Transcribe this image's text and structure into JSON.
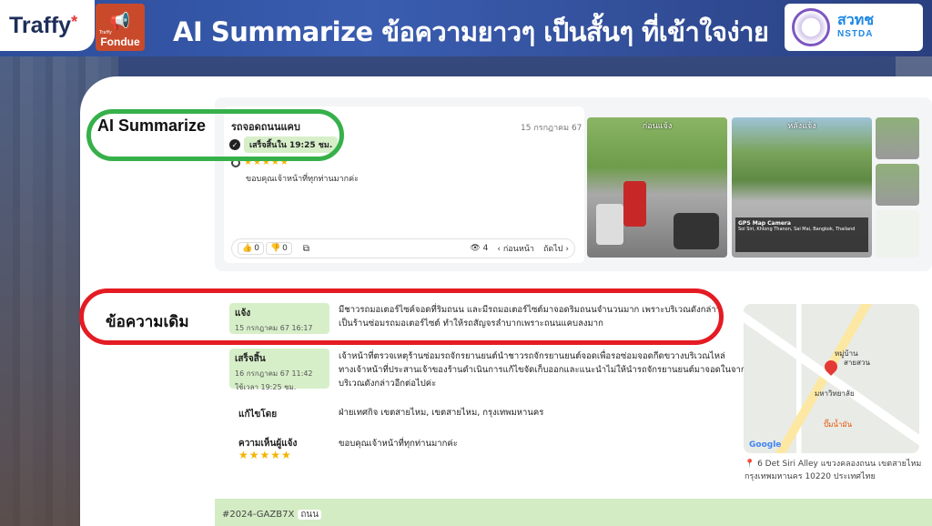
{
  "header": {
    "logo_traffy": "Traffy",
    "logo_traffy_star": "*",
    "logo_fondue_small": "Traffy",
    "logo_fondue_name": "Fondue",
    "title": "AI Summarize ข้อความยาวๆ เป็นสั้นๆ ที่เข้าใจง่าย",
    "nstda_thai": "สวทช",
    "nstda_en": "NSTDA"
  },
  "sections": {
    "ai_label": "AI Summarize",
    "orig_label": "ข้อความเดิม"
  },
  "summary_card": {
    "title": "รถจอดถนนแคบ",
    "date": "15 กรกฎาคม 67",
    "status": "เสร็จสิ้นใน 19:25 ชม.",
    "stars": "★★★★★",
    "comment": "ขอบคุณเจ้าหน้าที่ทุกท่านมากค่ะ",
    "like_count": "0",
    "dislike_count": "0",
    "view_count": "4",
    "prev_label": "ก่อนหน้า",
    "next_label": "ถัดไป"
  },
  "photos": {
    "before_caption": "ก่อนแจ้ง",
    "after_caption": "หลังแจ้ง",
    "gps_title": "GPS Map Camera",
    "gps_text": "Soi Siri, Khlong Thanon, Sai Mai, Bangkok, Thailand"
  },
  "original": {
    "report_label": "แจ้ง",
    "report_date": "15 กรกฎาคม 67 16:17",
    "report_text_1": "มีชาวรถมอเตอร์ไซค์จอดที่ริมถนน และมีรถมอเตอร์ไซต์มาจอดริมถนนจำนวนมาก เพราะบริเวณดังกล่าว",
    "report_text_2": "เป็นร้านซ่อมรถมอเตอร์ไซต์ ทำให้รถสัญจรลำบากเพราะถนนแคบลงมาก",
    "done_label": "เสร็จสิ้น",
    "done_date": "16 กรกฎาคม 67 11:42",
    "done_duration": "ใช้เวลา 19:25 ชม.",
    "done_text_1": "เจ้าหน้าที่ตรวจเหตุร้านซ่อมรถจักรยานยนต์นำชาวรถจักรยานยนต์จอดเพื่อรอซ่อมจอดกีดขวางบริเวณไหล่",
    "done_text_2": "ทางเจ้าหน้าที่ประสานเจ้าของร้านดำเนินการแก้ไขจัดเก็บออกและแนะนำไม่ให้นำรถจักรยานยนต์มาจอดในจาก",
    "done_text_3": "บริเวณดังกล่าวอีกต่อไปค่ะ",
    "resolved_by_label": "แก้ไขโดย",
    "resolved_by_value": "ฝ่ายเทศกิจ เขตสายไหม, เขตสายไหม, กรุงเทพมหานคร",
    "feedback_label": "ความเห็นผู้แจ้ง",
    "feedback_stars": "★★★★★",
    "feedback_value": "ขอบคุณเจ้าหน้าที่ทุกท่านมากค่ะ"
  },
  "map": {
    "label_1": "หมู่บ้าน",
    "label_2": "สายสวน",
    "label_3": "มหาวิทยาลัย",
    "label_4": "ปั๊มน้ำมัน",
    "google": "Google",
    "address_1": "6 Det Siri Alley แขวงคลองถนน เขตสายไหม",
    "address_2": "กรุงเทพมหานคร 10220 ประเทศไทย"
  },
  "footer": {
    "ticket_id": "#2024-GAZB7X",
    "tag": "ถนน"
  }
}
